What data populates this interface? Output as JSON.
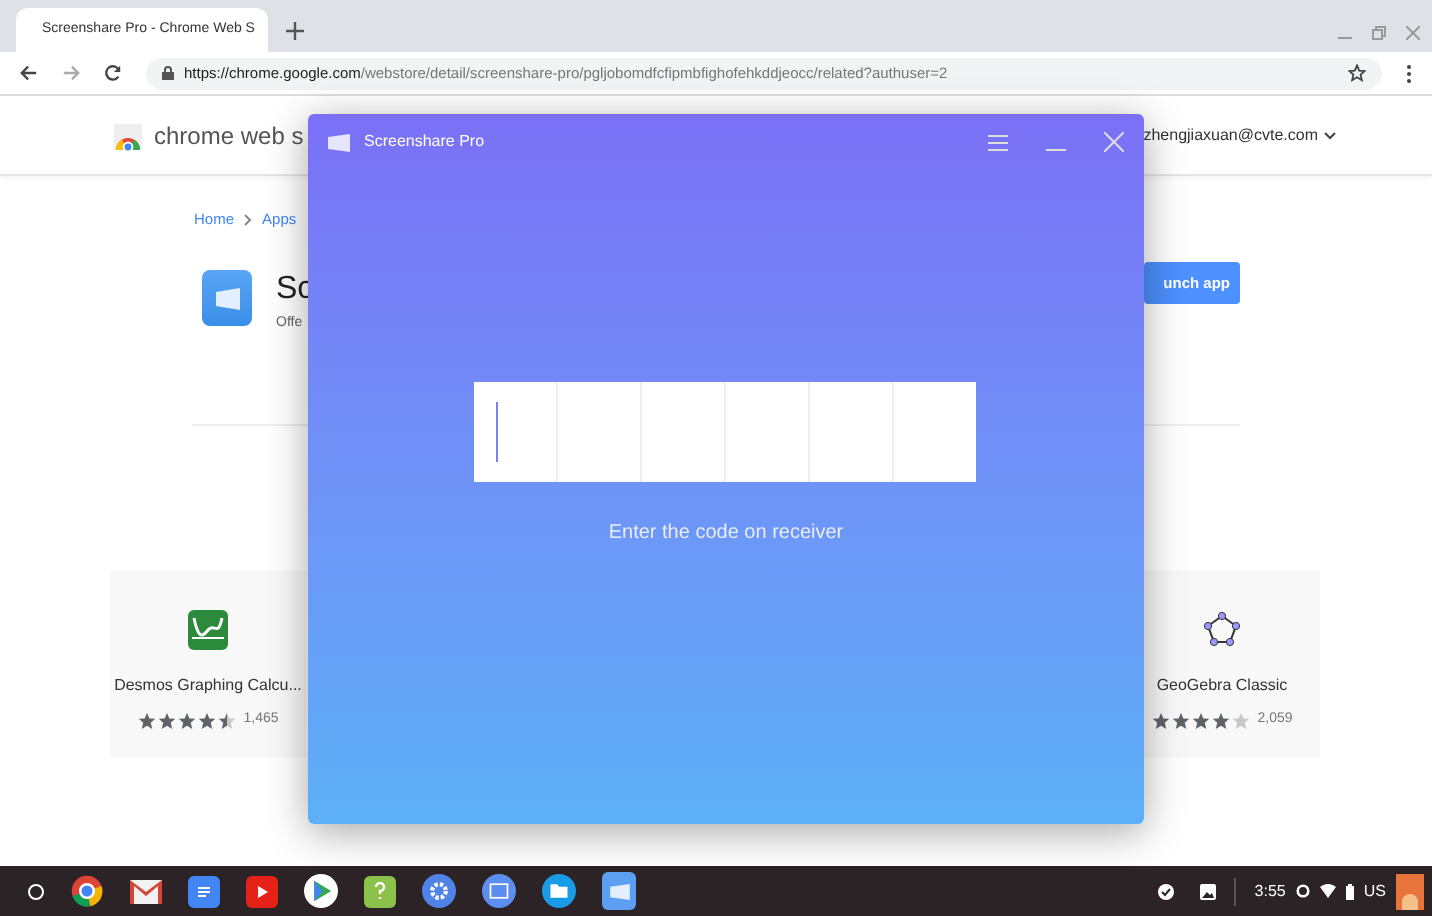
{
  "browser": {
    "tab": {
      "title": "Screenshare Pro - Chrome Web S",
      "selected": true
    },
    "url_host": "https://chrome.google.com",
    "url_path": "/webstore/detail/screenshare-pro/pgljobomdfcfipmbfighofehkddjeocc/related?authuser=2"
  },
  "store": {
    "brand": "chrome web s",
    "account": "zhengjiaxuan@cvte.com",
    "breadcrumbs": [
      "Home",
      "Apps"
    ],
    "app_title": "Sc",
    "offered": "Offe",
    "launch": "unch app"
  },
  "cards": [
    {
      "name": "Desmos Graphing Calcu...",
      "stars": 4.5,
      "count": "1,465"
    },
    {
      "name": "GeoGebra Classic",
      "stars": 4,
      "count": "2,059"
    }
  ],
  "dialog": {
    "title": "Screenshare Pro",
    "cells": [
      {
        "focused": true
      },
      {
        "focused": false
      },
      {
        "focused": false
      },
      {
        "focused": false
      },
      {
        "focused": false
      },
      {
        "focused": false
      }
    ],
    "hint": "Enter the code on receiver"
  },
  "taskbar": {
    "time": "3:55",
    "locale": "US"
  }
}
